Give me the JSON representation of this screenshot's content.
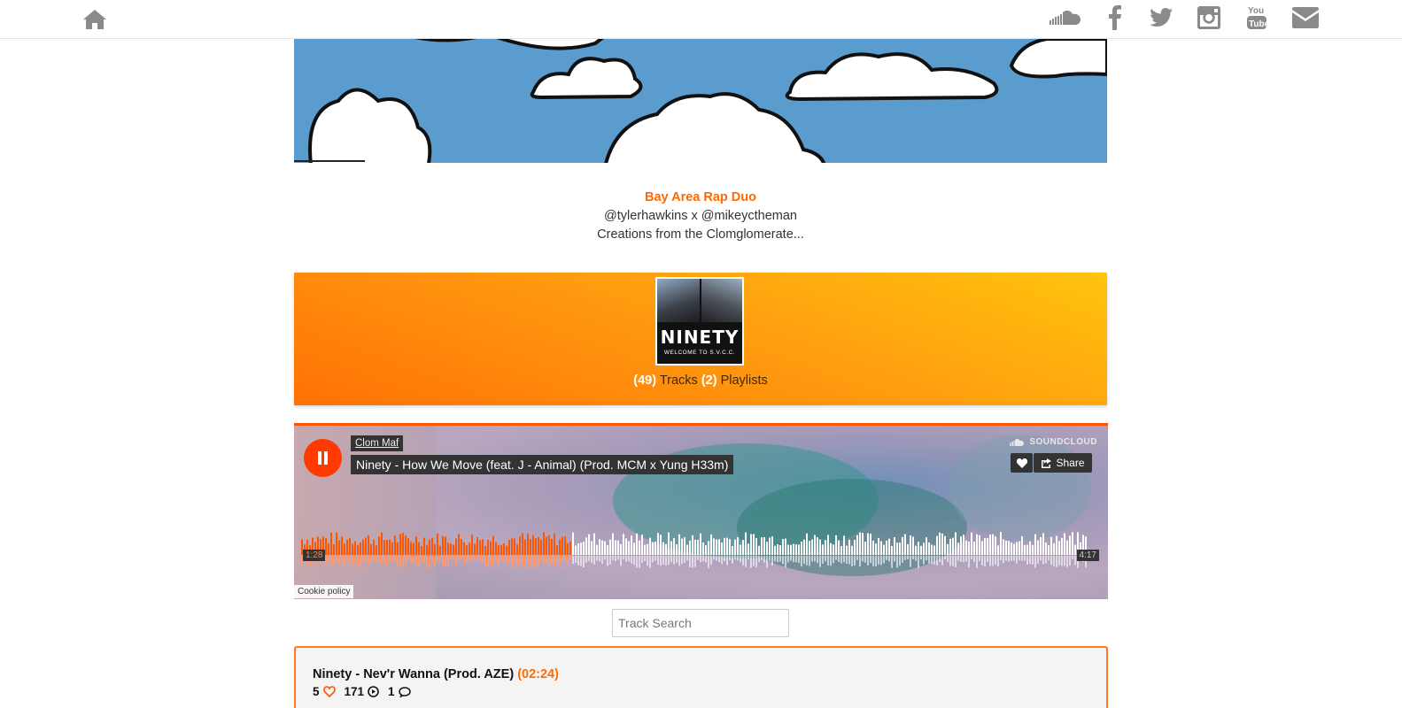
{
  "nav": {
    "home_icon": "home-icon",
    "social": [
      "soundcloud-icon",
      "facebook-icon",
      "twitter-icon",
      "instagram-icon",
      "youtube-icon",
      "envelope-icon"
    ],
    "icon_color": "#8a8a8a"
  },
  "bio": {
    "headline": "Bay Area Rap Duo",
    "handles": "@tylerhawkins x @mikeyctheman",
    "tagline": "Creations from the Clomglomerate..."
  },
  "profile": {
    "avatar_title": "NINETY",
    "avatar_subtitle": "WELCOME TO S.V.C.C.",
    "tracks_count": "(49)",
    "tracks_label": "Tracks",
    "playlists_count": "(2)",
    "playlists_label": "Playlists"
  },
  "player": {
    "artist": "Clom Maf",
    "track_title": "Ninety - How We Move (feat. J - Animal) (Prod. MCM x Yung H33m)",
    "brand": "SOUNDCLOUD",
    "share_label": "Share",
    "current_time": "1:28",
    "total_time": "4:17",
    "progress": 0.345,
    "cookie_label": "Cookie policy",
    "accent": "#ff5500"
  },
  "search": {
    "placeholder": "Track Search"
  },
  "tracks": [
    {
      "title": "Ninety - Nev'r Wanna (Prod. AZE)",
      "duration": "(02:24)",
      "likes": "5",
      "plays": "171",
      "comments": "1"
    }
  ]
}
